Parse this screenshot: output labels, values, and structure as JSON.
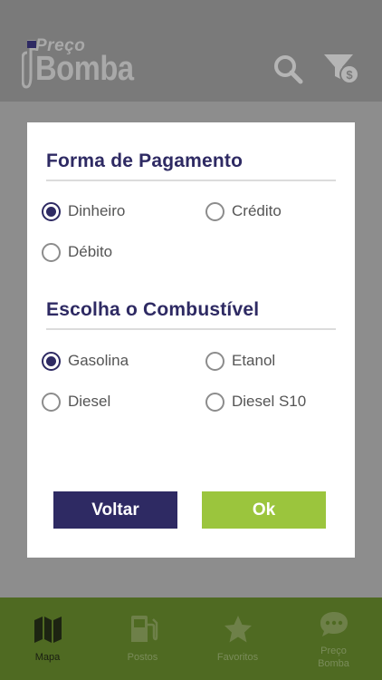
{
  "header": {
    "logo_top": "Preço",
    "logo_bottom": "Bomba",
    "search_icon": "search-icon",
    "filter_icon": "filter-dollar-icon"
  },
  "modal": {
    "payment": {
      "title": "Forma de Pagamento",
      "options": [
        {
          "label": "Dinheiro",
          "selected": true
        },
        {
          "label": "Crédito",
          "selected": false
        },
        {
          "label": "Débito",
          "selected": false
        }
      ]
    },
    "fuel": {
      "title": "Escolha o Combustível",
      "options": [
        {
          "label": "Gasolina",
          "selected": true
        },
        {
          "label": "Etanol",
          "selected": false
        },
        {
          "label": "Diesel",
          "selected": false
        },
        {
          "label": "Diesel S10",
          "selected": false
        }
      ]
    },
    "back_label": "Voltar",
    "ok_label": "Ok"
  },
  "tabbar": {
    "tabs": [
      {
        "label": "Mapa",
        "icon": "map-icon",
        "active": true
      },
      {
        "label": "Postos",
        "icon": "gas-station-icon",
        "active": false
      },
      {
        "label": "Favoritos",
        "icon": "star-icon",
        "active": false
      },
      {
        "label_line1": "Preço",
        "label_line2": "Bomba",
        "icon": "chat-icon",
        "active": false
      }
    ]
  },
  "colors": {
    "accent_dark": "#2e2a63",
    "accent_green": "#9bc53d",
    "tabbar": "#4f6a22"
  }
}
